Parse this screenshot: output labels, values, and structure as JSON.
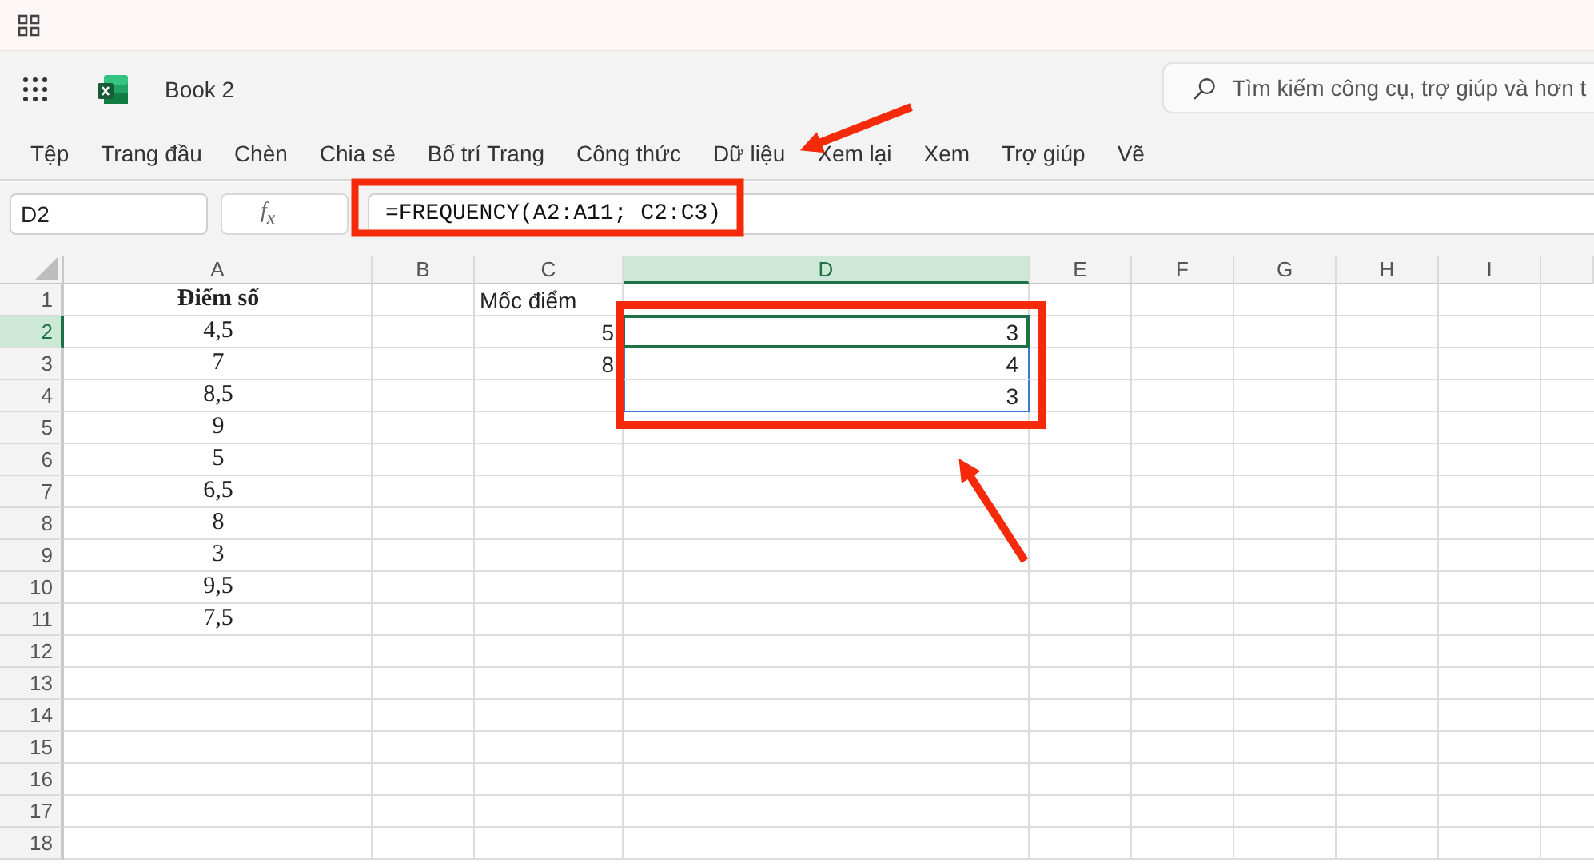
{
  "app": {
    "document_title": "Book 2",
    "search": {
      "placeholder": "Tìm kiếm công cụ, trợ giúp và hơn t"
    }
  },
  "ribbon_tabs": [
    "Tệp",
    "Trang đầu",
    "Chèn",
    "Chia sẻ",
    "Bố trí Trang",
    "Công thức",
    "Dữ liệu",
    "Xem lại",
    "Xem",
    "Trợ giúp",
    "Vẽ"
  ],
  "formula_bar": {
    "name_box": "D2",
    "function_label": "f$_{x}$",
    "formula": "=FREQUENCY(A2:A11; C2:C3)"
  },
  "sheet": {
    "columns": [
      {
        "label": "A",
        "selected": false
      },
      {
        "label": "B",
        "selected": false
      },
      {
        "label": "C",
        "selected": false
      },
      {
        "label": "D",
        "selected": true
      },
      {
        "label": "E",
        "selected": false
      },
      {
        "label": "F",
        "selected": false
      },
      {
        "label": "G",
        "selected": false
      },
      {
        "label": "H",
        "selected": false
      },
      {
        "label": "I",
        "selected": false
      }
    ],
    "rows": [
      {
        "label": "1",
        "selected": false,
        "cells": [
          {
            "text": "Điểm số",
            "kind": "text",
            "bold": true,
            "spill": false
          },
          null,
          {
            "text": "Mốc điểm",
            "kind": "text",
            "bold": false,
            "spill": false
          },
          null
        ]
      },
      {
        "label": "2",
        "selected": true,
        "cells": [
          {
            "text": "4,5",
            "kind": "number",
            "bold": false,
            "spill": false
          },
          null,
          {
            "text": "5",
            "kind": "number",
            "bold": false,
            "spill": false
          },
          {
            "text": "3",
            "kind": "number",
            "bold": false,
            "spill": true
          }
        ]
      },
      {
        "label": "3",
        "selected": false,
        "cells": [
          {
            "text": "7",
            "kind": "number",
            "bold": false,
            "spill": false
          },
          null,
          {
            "text": "8",
            "kind": "number",
            "bold": false,
            "spill": false
          },
          {
            "text": "4",
            "kind": "number",
            "bold": false,
            "spill": true
          }
        ]
      },
      {
        "label": "4",
        "selected": false,
        "cells": [
          {
            "text": "8,5",
            "kind": "number",
            "bold": false,
            "spill": false
          },
          null,
          null,
          {
            "text": "3",
            "kind": "number",
            "bold": false,
            "spill": true
          }
        ]
      },
      {
        "label": "5",
        "selected": false,
        "cells": [
          {
            "text": "9",
            "kind": "number",
            "bold": false,
            "spill": false
          },
          null,
          null,
          null
        ]
      },
      {
        "label": "6",
        "selected": false,
        "cells": [
          {
            "text": "5",
            "kind": "number",
            "bold": false,
            "spill": false
          },
          null,
          null,
          null
        ]
      },
      {
        "label": "7",
        "selected": false,
        "cells": [
          {
            "text": "6,5",
            "kind": "number",
            "bold": false,
            "spill": false
          },
          null,
          null,
          null
        ]
      },
      {
        "label": "8",
        "selected": false,
        "cells": [
          {
            "text": "8",
            "kind": "number",
            "bold": false,
            "spill": false
          },
          null,
          null,
          null
        ]
      },
      {
        "label": "9",
        "selected": false,
        "cells": [
          {
            "text": "3",
            "kind": "number",
            "bold": false,
            "spill": false
          },
          null,
          null,
          null
        ]
      },
      {
        "label": "10",
        "selected": false,
        "cells": [
          {
            "text": "9,5",
            "kind": "number",
            "bold": false,
            "spill": false
          },
          null,
          null,
          null
        ]
      },
      {
        "label": "11",
        "selected": false,
        "cells": [
          {
            "text": "7,5",
            "kind": "number",
            "bold": false,
            "spill": false
          },
          null,
          null,
          null
        ]
      },
      {
        "label": "12",
        "selected": false
      },
      {
        "label": "13",
        "selected": false
      },
      {
        "label": "14",
        "selected": false
      },
      {
        "label": "15",
        "selected": false
      },
      {
        "label": "16",
        "selected": false
      },
      {
        "label": "17",
        "selected": false
      },
      {
        "label": "18",
        "selected": false
      }
    ]
  }
}
